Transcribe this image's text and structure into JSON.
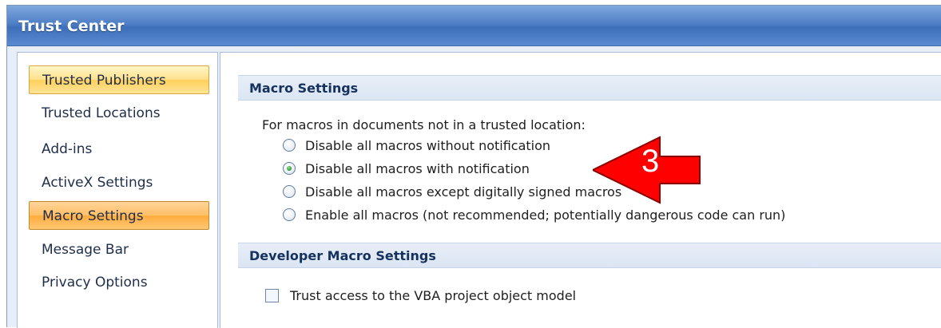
{
  "window": {
    "title": "Trust Center"
  },
  "nav": {
    "items": [
      {
        "label": "Trusted Publishers"
      },
      {
        "label": "Trusted Locations"
      },
      {
        "label": "Add-ins"
      },
      {
        "label": "ActiveX Settings"
      },
      {
        "label": "Macro Settings"
      },
      {
        "label": "Message Bar"
      },
      {
        "label": "Privacy Options"
      }
    ]
  },
  "macro_settings": {
    "header": "Macro Settings",
    "intro": "For macros in documents not in a trusted location:",
    "options": [
      {
        "label": "Disable all macros without notification",
        "checked": false
      },
      {
        "label": "Disable all macros with notification",
        "checked": true
      },
      {
        "label": "Disable all macros except digitally signed macros",
        "checked": false
      },
      {
        "label": "Enable all macros (not recommended; potentially dangerous code can run)",
        "checked": false
      }
    ]
  },
  "developer": {
    "header": "Developer Macro Settings",
    "checkbox_label": "Trust access to the VBA project object model",
    "checked": false
  },
  "annotation": {
    "number": "3",
    "color": "#ff0000"
  }
}
